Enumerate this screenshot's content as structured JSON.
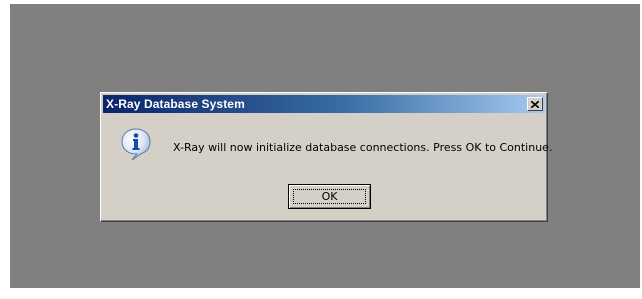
{
  "dialog": {
    "title": "X-Ray Database System",
    "close_icon": "close-icon",
    "icon": "info-icon",
    "message": "X-Ray will now initialize database connections.  Press OK to Continue.",
    "ok_label": "OK"
  },
  "colors": {
    "desktop": "#808080",
    "dialog_face": "#d4d0c8",
    "titlebar_start": "#0a246a",
    "titlebar_end": "#a6caf0",
    "title_text": "#ffffff"
  }
}
